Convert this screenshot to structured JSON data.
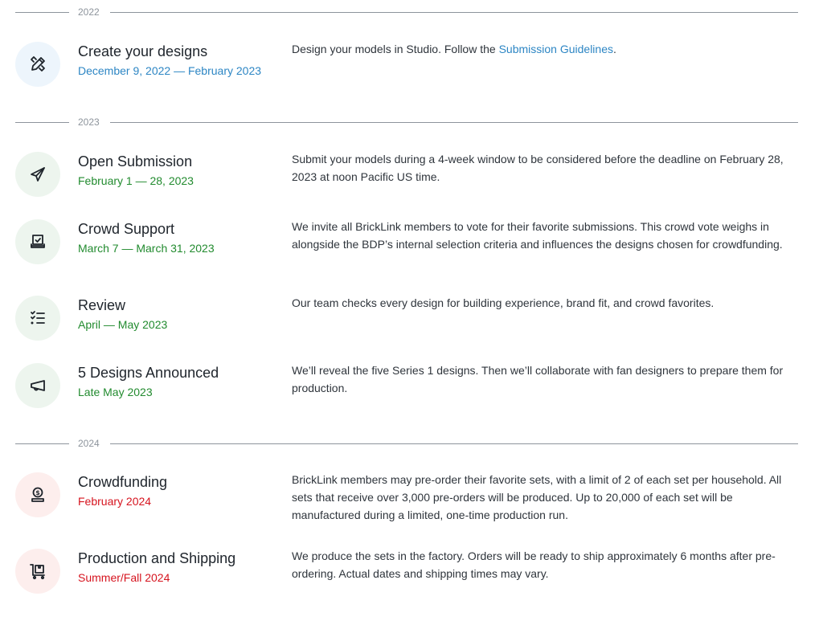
{
  "years": [
    "2022",
    "2023",
    "2024"
  ],
  "steps": [
    {
      "title": "Create your designs",
      "date": "December 9, 2022 — February 2023",
      "desc_prefix": "Design your models in Studio. Follow the ",
      "desc_link": "Submission Guidelines",
      "desc_suffix": ".",
      "icon": "pencil-ruler-icon",
      "color": "#2d86c4"
    },
    {
      "title": "Open Submission",
      "date": "February 1 — 28, 2023",
      "desc": "Submit your models during a 4-week window to be considered before the deadline on February 28, 2023 at noon Pacific US time.",
      "icon": "paper-plane-icon",
      "color": "#228b2f"
    },
    {
      "title": "Crowd Support",
      "date": "March 7 — March 31, 2023",
      "desc": "We invite all BrickLink members to vote for their favorite submissions. This crowd vote weighs in alongside the BDP’s internal selection criteria and influences the designs chosen for crowdfunding.",
      "icon": "ballot-box-icon",
      "color": "#228b2f"
    },
    {
      "title": "Review",
      "date": "April — May 2023",
      "desc": "Our team checks every design for building experience, brand fit, and crowd favorites.",
      "icon": "checklist-icon",
      "color": "#228b2f"
    },
    {
      "title": "5 Designs Announced",
      "date": "Late May 2023",
      "desc": "We’ll reveal the five Series 1 designs. Then we’ll collaborate with fan designers to prepare them for production.",
      "icon": "megaphone-icon",
      "color": "#228b2f"
    },
    {
      "title": "Crowdfunding",
      "date": "February 2024",
      "desc": "BrickLink members may pre-order their favorite sets, with a limit of 2 of each set per household. All sets that receive over 3,000 pre-orders will be produced. Up to 20,000 of each set will be manufactured during a limited, one-time production run.",
      "icon": "coin-hand-icon",
      "color": "#d6141f"
    },
    {
      "title": "Production and Shipping",
      "date": "Summer/Fall 2024",
      "desc": "We produce the sets in the factory. Orders will be ready to ship approximately 6 months after pre-ordering. Actual dates and shipping times may vary.",
      "icon": "cart-box-icon",
      "color": "#d6141f"
    }
  ]
}
